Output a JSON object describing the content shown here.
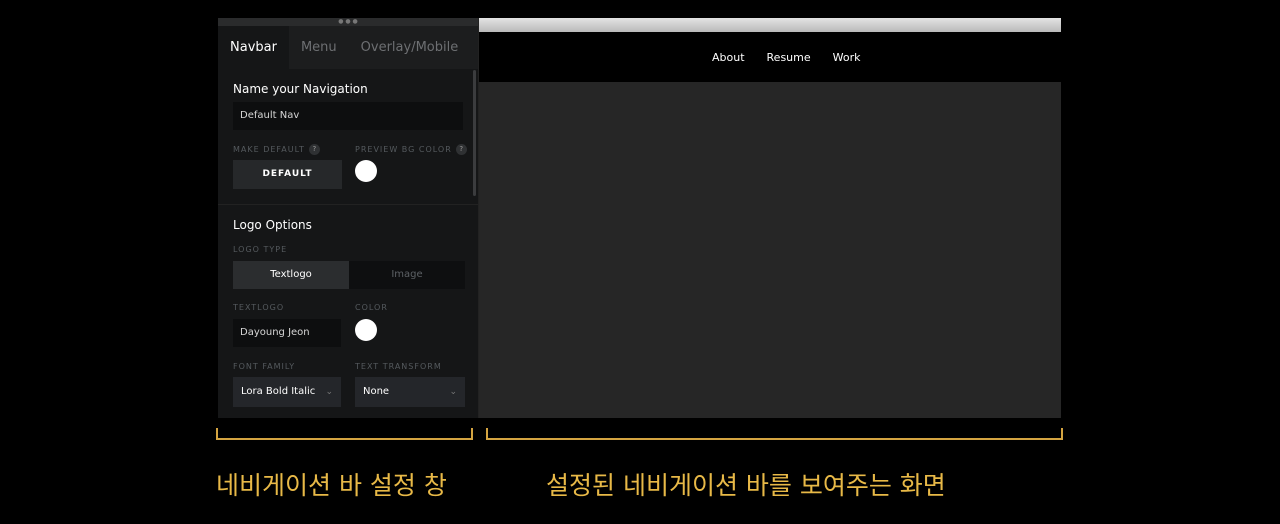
{
  "panel": {
    "tabs": [
      "Navbar",
      "Menu",
      "Overlay/Mobile"
    ],
    "navigation": {
      "title": "Name your Navigation",
      "name_value": "Default Nav",
      "make_default_label": "MAKE DEFAULT",
      "preview_bg_label": "PREVIEW BG COLOR",
      "default_button": "DEFAULT",
      "preview_bg_color": "#ffffff",
      "help_glyph": "?"
    },
    "logo": {
      "title": "Logo Options",
      "logo_type_label": "LOGO TYPE",
      "logo_type_options": [
        "Textlogo",
        "Image"
      ],
      "logo_type_selected": "Textlogo",
      "textlogo_label": "TEXTLOGO",
      "textlogo_value": "Dayoung Jeon",
      "color_label": "COLOR",
      "color_value": "#ffffff",
      "font_family_label": "FONT FAMILY",
      "font_family_value": "Lora Bold Italic",
      "text_transform_label": "TEXT TRANSFORM",
      "text_transform_value": "None"
    }
  },
  "preview": {
    "nav_links": [
      "About",
      "Resume",
      "Work"
    ]
  },
  "captions": {
    "left": "네비게이션 바 설정 창",
    "right": "설정된 네비게이션 바를 보여주는 화면"
  },
  "colors": {
    "caption": "#e8b947",
    "bracket": "#d4a441"
  }
}
